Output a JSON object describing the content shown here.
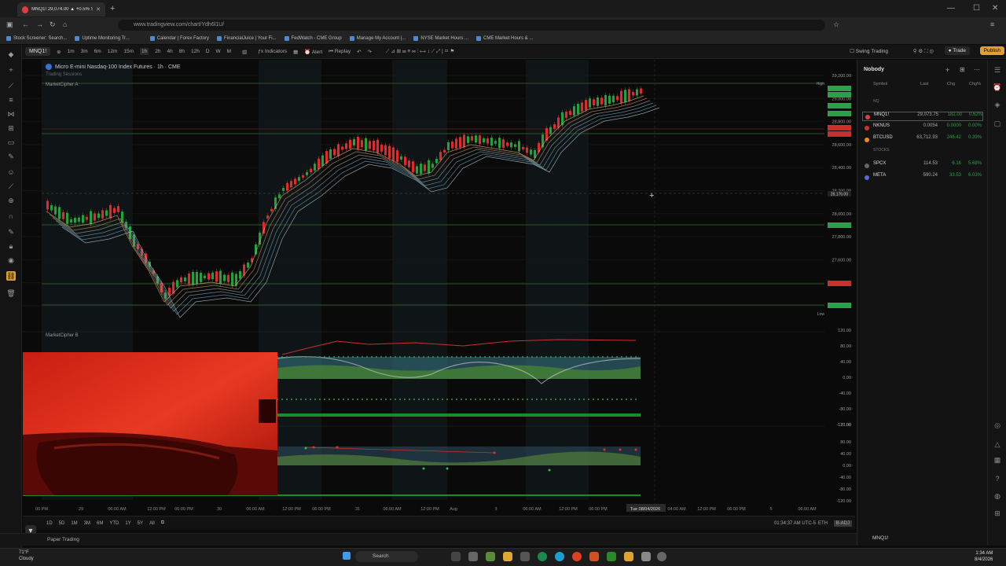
{
  "browser": {
    "tab_title": "MNQ1! 29,074.00 ▲ +0.5% Swi",
    "url": "www.tradingview.com/chart/Ydh6l1U/",
    "bookmarks": [
      "Stock Screener: Search...",
      "Uptime Monitoring Tr...",
      "Calendar | Forex Factory",
      "FinancialJuice | Your Fi...",
      "FedWatch - CME Group",
      "Manage My Account |...",
      "NYSE Market Hours ...",
      "CME Market Hours & ..."
    ]
  },
  "toolbar": {
    "symbol": "MNQ1!",
    "intervals": [
      "1m",
      "3m",
      "6m",
      "12m",
      "15m",
      "1h",
      "2h",
      "4h",
      "8h",
      "12h",
      "D",
      "W",
      "M"
    ],
    "active_interval": "1h",
    "indicators": "Indicators",
    "alert": "Alert",
    "replay": "Replay",
    "layout": "Swing Trading",
    "trade": "Trade",
    "publish": "Publish"
  },
  "chart": {
    "title": "Micro E-mini Nasdaq-100 Index Futures · 1h · CME",
    "session": "Trading Sessions",
    "indicator_a": "MarketCipher A",
    "indicator_b": "MarketCipher B",
    "price_labels": [
      "29,200.00",
      "29,000.00",
      "28,800.00",
      "28,600.00",
      "28,400.00",
      "28,200.00",
      "28,000.00",
      "27,800.00",
      "27,600.00",
      "27,400.00",
      "27,200.00"
    ],
    "high_label": "High",
    "low_label": "Low",
    "cursor_price": "28,176.00",
    "osc_labels": [
      "120.00",
      "80.00",
      "40.00",
      "0.00",
      "-40.00",
      "-80.00",
      "-120.00",
      "120.00",
      "80.00",
      "40.00",
      "0.00",
      "-40.00",
      "-80.00",
      "-120.00"
    ],
    "time_labels": [
      "00 PM",
      "29",
      "06:00 AM",
      "12:00 PM",
      "06:00 PM",
      "30",
      "06:00 AM",
      "12:00 PM",
      "06:00 PM",
      "31",
      "06:00 AM",
      "12:00 PM",
      "Aug",
      "3",
      "06:00 AM",
      "12:00 PM",
      "06:00 PM",
      "Tue 08/04/2026",
      "04:00 AM",
      "12:00 PM",
      "06:00 PM",
      "5",
      "06:00 AM"
    ],
    "colors": {
      "up": "#1fa33a",
      "down": "#e22a2a",
      "bg": "#0a0a0a"
    }
  },
  "bottombar": {
    "ranges": [
      "1D",
      "5D",
      "1M",
      "3M",
      "6M",
      "YTD",
      "1Y",
      "5Y",
      "All"
    ],
    "clock": "01:34:37 AM UTC-5",
    "eth": "ETH",
    "badj": "B-ADJ"
  },
  "paper_trading": "Paper Trading",
  "watchlist": {
    "name": "Nobody",
    "columns": [
      "Symbol",
      "Last",
      "Chg",
      "Chg%"
    ],
    "section1": "NQ",
    "section2": "STOCKS",
    "rows": [
      {
        "sym": "MNQ1!",
        "last": "29,073.75",
        "chg": "182.00",
        "chgp": "0.62%",
        "color": "#e04040"
      },
      {
        "sym": "NKNUS",
        "last": "0.0054",
        "chg": "0.0000",
        "chgp": "0.00%",
        "color": "#d03030"
      },
      {
        "sym": "BTCUSD",
        "last": "63,712.93",
        "chg": "246.42",
        "chgp": "0.39%",
        "color": "#f08a20"
      },
      {
        "sym": "SPCX",
        "last": "114.53",
        "chg": "6.16",
        "chgp": "5.68%",
        "color": "#666666"
      },
      {
        "sym": "META",
        "last": "590.24",
        "chg": "33.53",
        "chgp": "6.03%",
        "color": "#5a6ad0"
      }
    ],
    "footer_symbol": "MNQ1!"
  },
  "taskbar": {
    "weather_temp": "71°F",
    "weather_desc": "Cloudy",
    "search": "Search",
    "time": "1:34 AM",
    "date": "8/4/2026"
  }
}
